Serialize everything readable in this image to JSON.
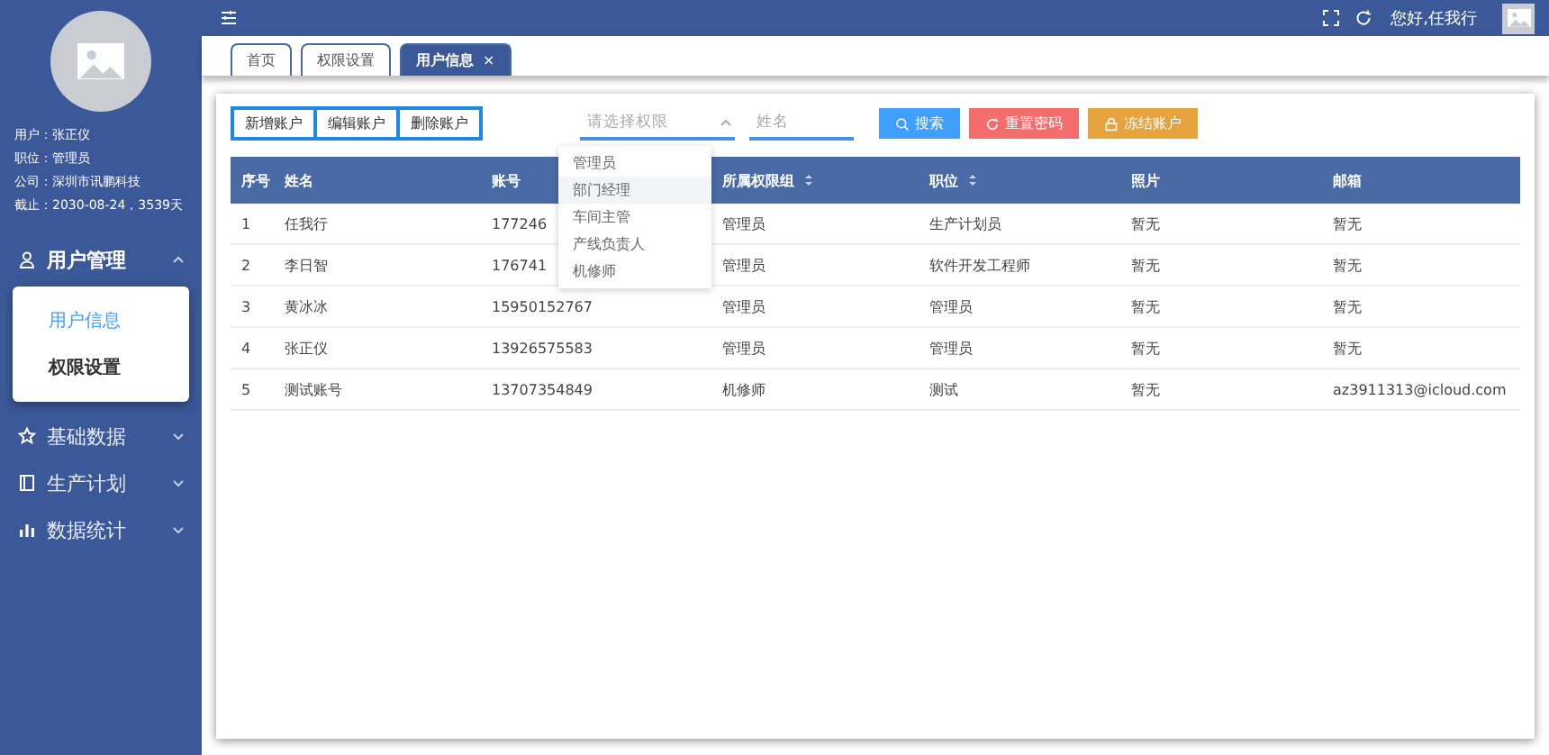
{
  "sidebar": {
    "user_info": [
      "用户：张正仪",
      "职位：管理员",
      "公司：深圳市讯鹏科技",
      "截止：2030-08-24，3539天"
    ],
    "menu": [
      {
        "label": "用户管理",
        "expanded": true,
        "children": [
          {
            "label": "用户信息",
            "selected": true
          },
          {
            "label": "权限设置",
            "selected": false
          }
        ]
      },
      {
        "label": "基础数据",
        "expanded": false
      },
      {
        "label": "生产计划",
        "expanded": false
      },
      {
        "label": "数据统计",
        "expanded": false
      }
    ]
  },
  "topbar": {
    "greeting": "您好,任我行"
  },
  "tabs": [
    {
      "label": "首页",
      "selected": false
    },
    {
      "label": "权限设置",
      "selected": false
    },
    {
      "label": "用户信息",
      "selected": true,
      "close": "×"
    }
  ],
  "toolbar": {
    "group_buttons": [
      "新增账户",
      "编辑账户",
      "删除账户"
    ],
    "role_select": {
      "placeholder": "请选择权限",
      "open": true,
      "options": [
        {
          "label": "管理员",
          "highlighted": false
        },
        {
          "label": "部门经理",
          "highlighted": true
        },
        {
          "label": "车间主管",
          "highlighted": false
        },
        {
          "label": "产线负责人",
          "highlighted": false
        },
        {
          "label": "机修师",
          "highlighted": false
        }
      ]
    },
    "name_field": {
      "placeholder": "姓名"
    },
    "action_buttons": [
      {
        "label": "搜索",
        "kind": "search",
        "color": "#409eff"
      },
      {
        "label": "重置密码",
        "kind": "reset",
        "color": "#f56c6c"
      },
      {
        "label": "冻结账户",
        "kind": "lock",
        "color": "#e6a23c"
      }
    ]
  },
  "table": {
    "columns": [
      {
        "label": "序号",
        "sortable": false
      },
      {
        "label": "姓名",
        "sortable": false
      },
      {
        "label": "账号",
        "sortable": false
      },
      {
        "label": "所属权限组",
        "sortable": true
      },
      {
        "label": "职位",
        "sortable": true
      },
      {
        "label": "照片",
        "sortable": false
      },
      {
        "label": "邮箱",
        "sortable": false
      }
    ],
    "rows": [
      [
        "1",
        "任我行",
        "177246",
        "管理员",
        "生产计划员",
        "暂无",
        "暂无"
      ],
      [
        "2",
        "李日智",
        "176741",
        "管理员",
        "软件开发工程师",
        "暂无",
        "暂无"
      ],
      [
        "3",
        "黄冰冰",
        "15950152767",
        "管理员",
        "管理员",
        "暂无",
        "暂无"
      ],
      [
        "4",
        "张正仪",
        "13926575583",
        "管理员",
        "管理员",
        "暂无",
        "暂无"
      ],
      [
        "5",
        "测试账号",
        "13707354849",
        "机修师",
        "测试",
        "暂无",
        "az3911313@icloud.com"
      ]
    ]
  }
}
